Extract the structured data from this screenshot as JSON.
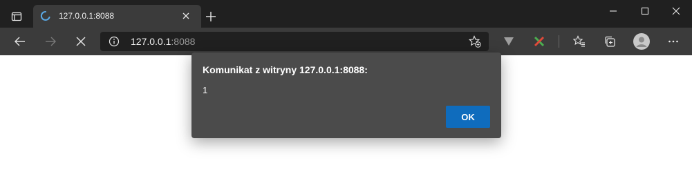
{
  "tab": {
    "title": "127.0.0.1:8088"
  },
  "address_bar": {
    "host": "127.0.0.1",
    "port": ":8088"
  },
  "dialog": {
    "title": "Komunikat z witryny 127.0.0.1:8088:",
    "message": "1",
    "ok_label": "OK"
  },
  "colors": {
    "titlebar": "#202020",
    "toolbar": "#3b3b3b",
    "dialog_bg": "#4b4b4b",
    "accent": "#0f6cbd",
    "page_bg": "#ffffff"
  },
  "icons": [
    "tab-actions-icon",
    "loading-spinner-icon",
    "close-icon",
    "plus-icon",
    "minimize-icon",
    "maximize-icon",
    "close-window-icon",
    "back-arrow-icon",
    "forward-arrow-icon",
    "stop-icon",
    "info-icon",
    "add-favorite-icon",
    "extension-v-icon",
    "extension-x-icon",
    "favorites-icon",
    "collections-icon",
    "profile-avatar-icon",
    "more-icon"
  ]
}
